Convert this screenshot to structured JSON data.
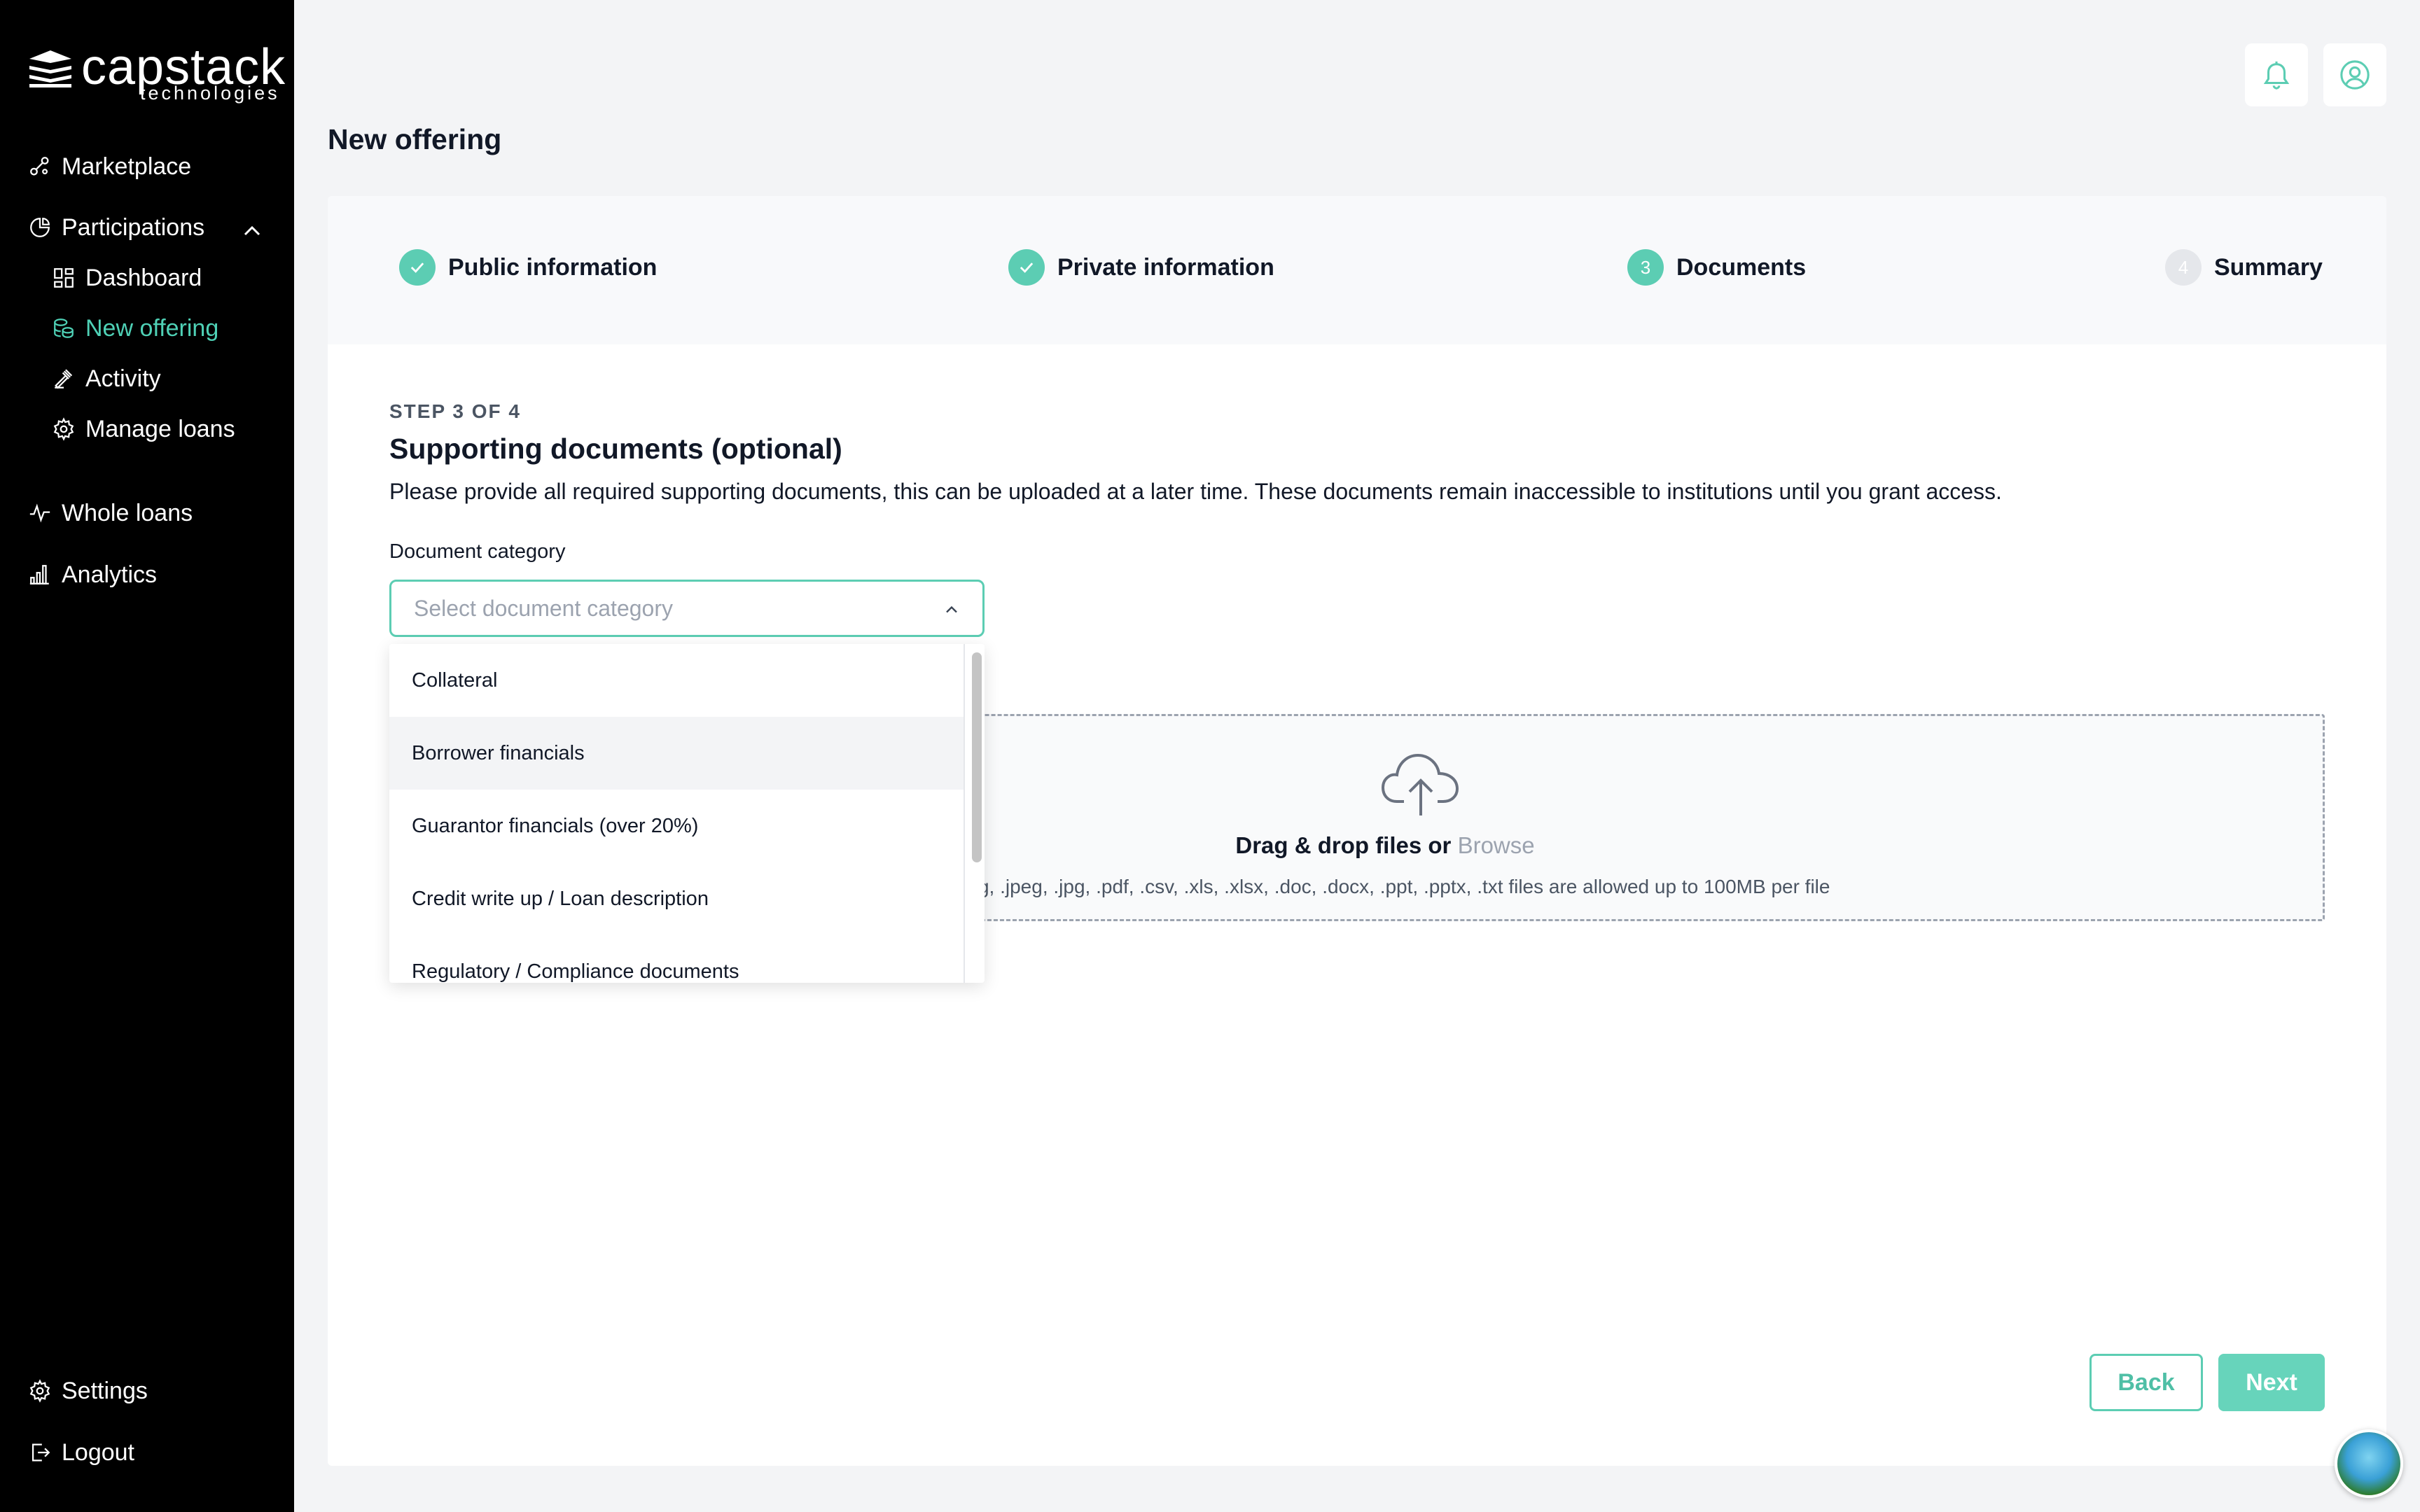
{
  "brand": {
    "name": "capstack",
    "sub": "technologies"
  },
  "sidebar": {
    "marketplace": "Marketplace",
    "participations": "Participations",
    "dashboard": "Dashboard",
    "new_offering": "New offering",
    "activity": "Activity",
    "manage_loans": "Manage loans",
    "whole_loans": "Whole loans",
    "analytics": "Analytics",
    "settings": "Settings",
    "logout": "Logout"
  },
  "page": {
    "title": "New offering"
  },
  "stepper": {
    "steps": [
      {
        "label": "Public information",
        "state": "done"
      },
      {
        "label": "Private information",
        "state": "done"
      },
      {
        "label": "Documents",
        "state": "current",
        "number": "3"
      },
      {
        "label": "Summary",
        "state": "upcoming",
        "number": "4"
      }
    ]
  },
  "form": {
    "step_label": "STEP 3 OF 4",
    "title": "Supporting documents (optional)",
    "description": "Please provide all required supporting documents, this can be uploaded at a later time. These documents remain inaccessible to institutions until you grant access.",
    "category_label": "Document category",
    "category_placeholder": "Select document category",
    "options": [
      "Collateral",
      "Borrower financials",
      "Guarantor financials (over 20%)",
      "Credit write up / Loan description",
      "Regulatory / Compliance documents"
    ]
  },
  "dropzone": {
    "main": "Drag & drop files or",
    "browse": "Browse",
    "sub": ": .png, .jpeg, .jpg, .pdf, .csv, .xls, .xlsx, .doc, .docx, .ppt, .pptx, .txt files are allowed up to 100MB per file"
  },
  "actions": {
    "back": "Back",
    "next": "Next"
  },
  "colors": {
    "accent": "#5ccdb3",
    "sidebar_bg": "#000000",
    "active_nav": "#4fd1b6"
  }
}
